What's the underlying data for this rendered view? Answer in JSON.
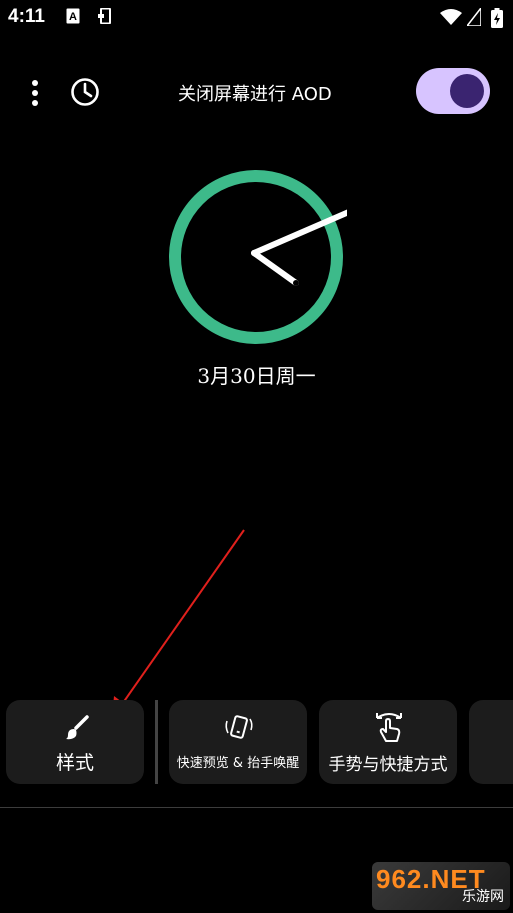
{
  "status_bar": {
    "time": "4:11"
  },
  "header": {
    "title": "关闭屏幕进行 AOD",
    "toggle_on": true
  },
  "clock": {
    "date": "3月30日周一",
    "ring_color": "#3dba8a"
  },
  "cards": [
    {
      "label": "样式",
      "icon": "brush-icon"
    },
    {
      "label": "快速预览 & 抬手唤醒",
      "icon": "phone-wave-icon"
    },
    {
      "label": "手势与快捷方式",
      "icon": "tap-gesture-icon"
    }
  ],
  "colors": {
    "accent": "#d7c4ff",
    "toggle_knob": "#3a2470",
    "annotation_arrow": "#e0201c"
  },
  "watermark": {
    "main": "962.NET",
    "sub": "乐游网"
  }
}
